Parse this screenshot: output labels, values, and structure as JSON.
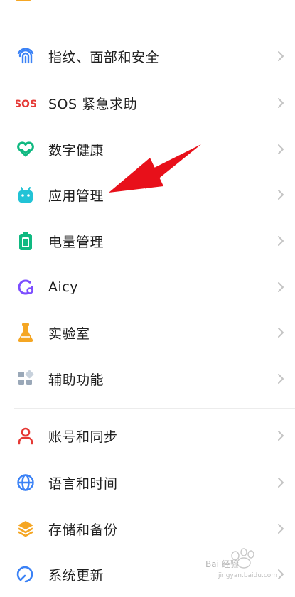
{
  "settings": {
    "items": [
      {
        "label": "指纹、面部和安全",
        "icon": "fingerprint-icon",
        "color": "#3b82f6"
      },
      {
        "label": "SOS 紧急求助",
        "icon": "sos-icon",
        "color": "#e53935"
      },
      {
        "label": "数字健康",
        "icon": "heart-icon",
        "color": "#10b981"
      },
      {
        "label": "应用管理",
        "icon": "android-icon",
        "color": "#22c3d6"
      },
      {
        "label": "电量管理",
        "icon": "battery-icon",
        "color": "#10b981"
      },
      {
        "label": "Aicy",
        "icon": "aicy-icon",
        "color": "#7c4dff"
      },
      {
        "label": "实验室",
        "icon": "flask-icon",
        "color": "#f5a623"
      },
      {
        "label": "辅助功能",
        "icon": "grid-icon",
        "color": "#9aa8b8"
      },
      {
        "label": "账号和同步",
        "icon": "person-icon",
        "color": "#e53935"
      },
      {
        "label": "语言和时间",
        "icon": "globe-icon",
        "color": "#3b82f6"
      },
      {
        "label": "存储和备份",
        "icon": "layers-icon",
        "color": "#f5a623"
      },
      {
        "label": "系统更新",
        "icon": "update-icon",
        "color": "#3b82f6"
      }
    ]
  },
  "annotation": {
    "color": "#e8101a"
  },
  "watermark": {
    "main": "Bai 经验",
    "sub": "jingyan.baidu.com"
  }
}
